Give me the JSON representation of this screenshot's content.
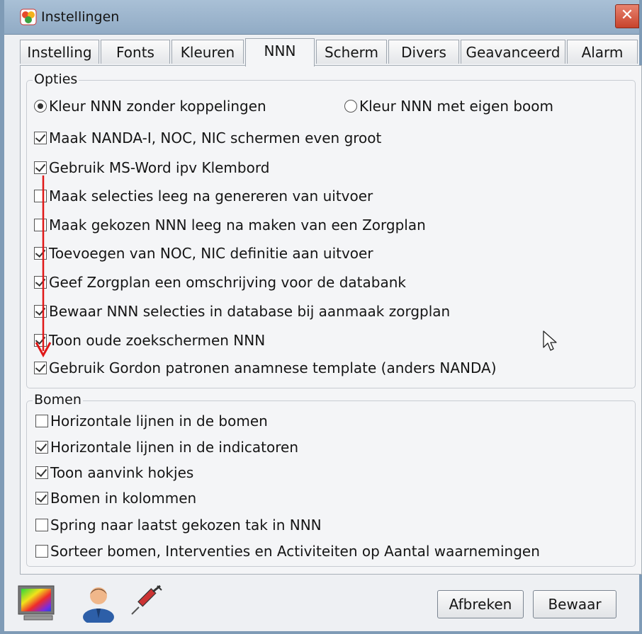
{
  "window": {
    "title": "Instellingen",
    "close_glyph": "✕"
  },
  "tabs": [
    {
      "label": "Instelling"
    },
    {
      "label": "Fonts"
    },
    {
      "label": "Kleuren"
    },
    {
      "label": "NNN",
      "active": true
    },
    {
      "label": "Scherm"
    },
    {
      "label": "Divers"
    },
    {
      "label": "Geavanceerd"
    },
    {
      "label": "Alarm"
    }
  ],
  "opties": {
    "title": "Opties",
    "radios": [
      {
        "label": "Kleur NNN zonder koppelingen",
        "selected": true
      },
      {
        "label": "Kleur NNN met eigen boom",
        "selected": false
      }
    ],
    "checkboxes": [
      {
        "label": "Maak NANDA-I, NOC, NIC schermen even groot",
        "checked": true
      },
      {
        "label": "Gebruik MS-Word ipv Klembord",
        "checked": true
      },
      {
        "label": "Maak selecties leeg na genereren van uitvoer",
        "checked": false
      },
      {
        "label": "Maak gekozen NNN leeg na maken van een Zorgplan",
        "checked": false
      },
      {
        "label": "Toevoegen van NOC, NIC definitie aan uitvoer",
        "checked": true
      },
      {
        "label": "Geef Zorgplan een omschrijving voor de databank",
        "checked": true
      },
      {
        "label": "Bewaar NNN selecties in database bij aanmaak zorgplan",
        "checked": true
      },
      {
        "label": "Toon oude zoekschermen NNN",
        "checked": true
      },
      {
        "label": "Gebruik Gordon patronen anamnese template (anders NANDA)",
        "checked": true
      }
    ]
  },
  "bomen": {
    "title": "Bomen",
    "checkboxes": [
      {
        "label": "Horizontale lijnen in de bomen",
        "checked": false
      },
      {
        "label": "Horizontale lijnen in de indicatoren",
        "checked": true
      },
      {
        "label": "Toon aanvink hokjes",
        "checked": true
      },
      {
        "label": "Bomen in kolommen",
        "checked": true
      },
      {
        "label": "Spring naar laatst gekozen tak in NNN",
        "checked": false
      },
      {
        "label": "Sorteer bomen, Interventies en Activiteiten op Aantal waarnemingen",
        "checked": false
      }
    ]
  },
  "buttons": {
    "cancel": "Afbreken",
    "save": "Bewaar"
  },
  "icons": {
    "app": "app-logo-icon",
    "monitor": "monitor-icon",
    "user": "user-icon",
    "syringe": "syringe-icon",
    "cursor": "mouse-cursor-icon"
  },
  "colors": {
    "annotation_arrow": "#e01818"
  }
}
